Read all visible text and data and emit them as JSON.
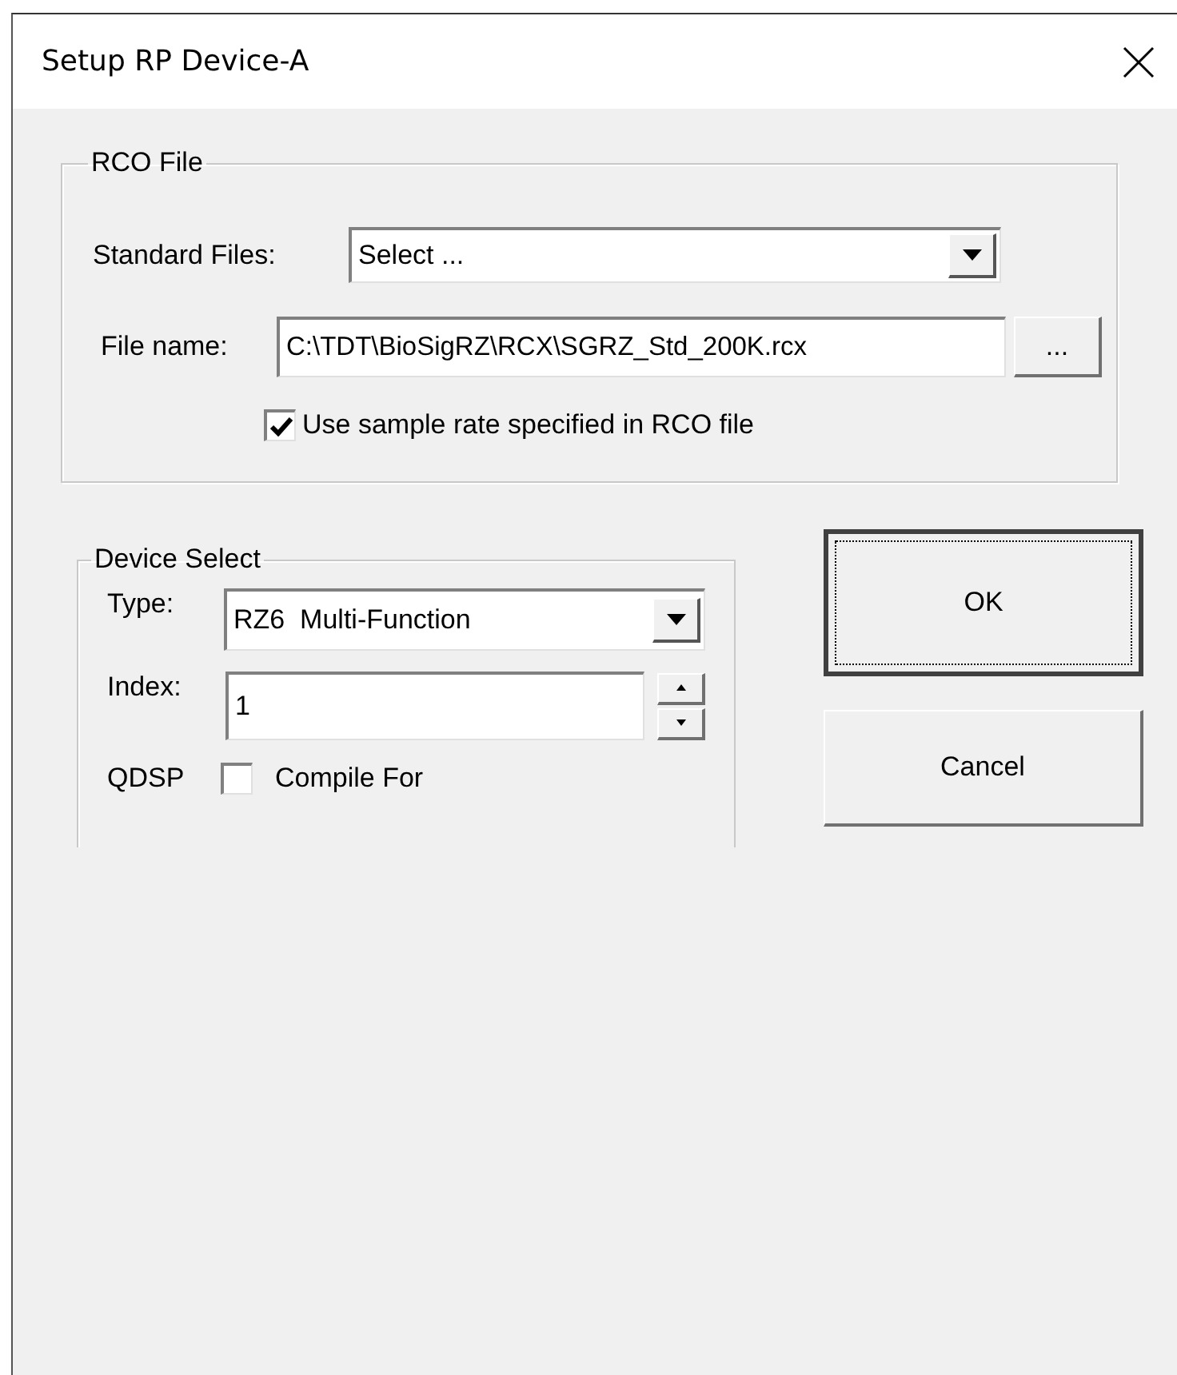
{
  "window": {
    "title": "Setup RP Device-A"
  },
  "rco_file": {
    "title": "RCO File",
    "standard_files": {
      "label": "Standard Files:",
      "value": "Select ..."
    },
    "file_name": {
      "label": "File name:",
      "value": "C:\\TDT\\BioSigRZ\\RCX\\SGRZ_Std_200K.rcx",
      "browse": "..."
    },
    "use_sample_rate": {
      "label": "Use sample rate specified in RCO file",
      "checked": true
    }
  },
  "device_select": {
    "title": "Device Select",
    "type": {
      "label": "Type:",
      "value": "RZ6  Multi-Function"
    },
    "index": {
      "label": "Index:",
      "value": "1"
    },
    "qdsp": {
      "label": "QDSP",
      "checkbox_label": "Compile For",
      "checked": false
    }
  },
  "buttons": [
    {
      "label": "OK",
      "default": true
    },
    {
      "label": "Cancel",
      "default": false
    }
  ]
}
